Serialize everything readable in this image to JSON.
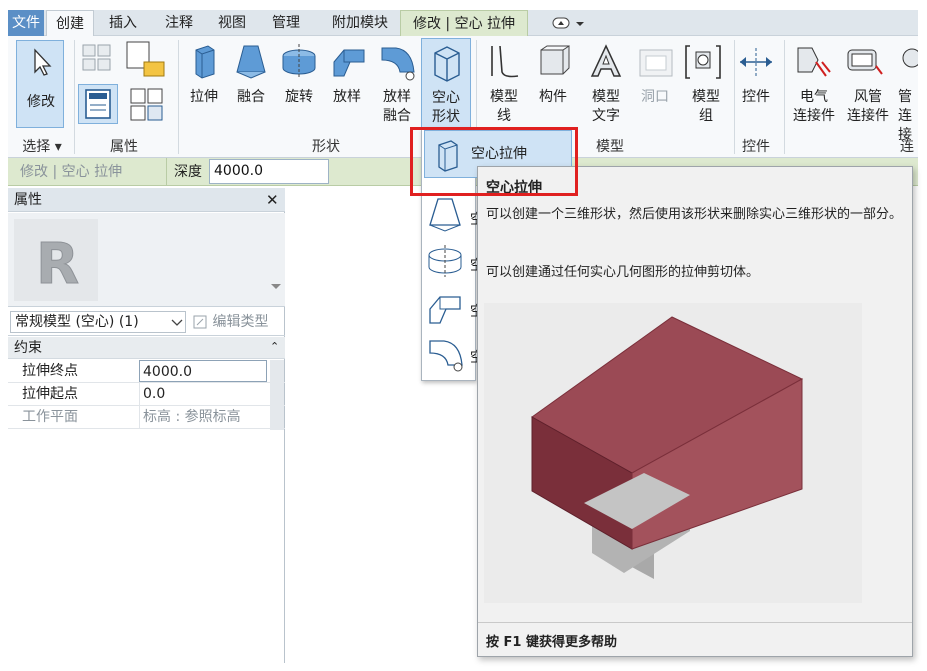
{
  "tabs": [
    {
      "label": "文件"
    },
    {
      "label": "创建"
    },
    {
      "label": "插入"
    },
    {
      "label": "注释"
    },
    {
      "label": "视图"
    },
    {
      "label": "管理"
    },
    {
      "label": "附加模块"
    },
    {
      "label": "修改 | 空心 拉伸"
    }
  ],
  "ribbon": {
    "select": {
      "label": "修改",
      "panel": "选择 ▾"
    },
    "properties_panel": "属性",
    "shapes": [
      {
        "label": "拉伸"
      },
      {
        "label": "融合"
      },
      {
        "label": "旋转"
      },
      {
        "label": "放样"
      },
      {
        "label_1": "放样",
        "label_2": "融合"
      },
      {
        "label_1": "空心",
        "label_2": "形状"
      }
    ],
    "shapes_panel": "形状",
    "model": [
      {
        "label_1": "模型",
        "label_2": "线"
      },
      {
        "label": "构件"
      },
      {
        "label_1": "模型",
        "label_2": "文字"
      },
      {
        "label": "洞口"
      },
      {
        "label_1": "模型",
        "label_2": "组"
      }
    ],
    "model_panel": "模型",
    "controls": {
      "label": "控件",
      "panel": "控件"
    },
    "connectors": [
      {
        "label_1": "电气",
        "label_2": "连接件"
      },
      {
        "label_1": "风管",
        "label_2": "连接件"
      },
      {
        "label_1": "管",
        "label_2": "连接"
      }
    ],
    "connectors_panel": "连"
  },
  "options_bar": {
    "context": "修改 | 空心 拉伸",
    "depth_label": "深度",
    "depth_value": "4000.0"
  },
  "properties": {
    "title": "属性",
    "close": "✕",
    "type_name": "常规模型 (空心) (1)",
    "edit_type": "编辑类型",
    "section": "约束",
    "rows": [
      {
        "key": "拉伸终点",
        "value": "4000.0"
      },
      {
        "key": "拉伸起点",
        "value": "0.0"
      },
      {
        "key": "工作平面",
        "value": "标高 : 参照标高"
      }
    ]
  },
  "dropdown": {
    "selected": "空心拉伸",
    "items": [
      "空心融合",
      "空心旋转",
      "空心放样",
      "空心放样融合"
    ]
  },
  "tooltip": {
    "title": "空心拉伸",
    "desc1": "可以创建一个三维形状，然后使用该形状来删除实心三维形状的一部分。",
    "desc2": "可以创建通过任何实心几何图形的拉伸剪切体。",
    "footer": "按 F1 键获得更多帮助"
  },
  "colors": {
    "hollow_solid": "#9b4a55",
    "highlight": "#e02020",
    "context_tab": "#dde9cf"
  }
}
